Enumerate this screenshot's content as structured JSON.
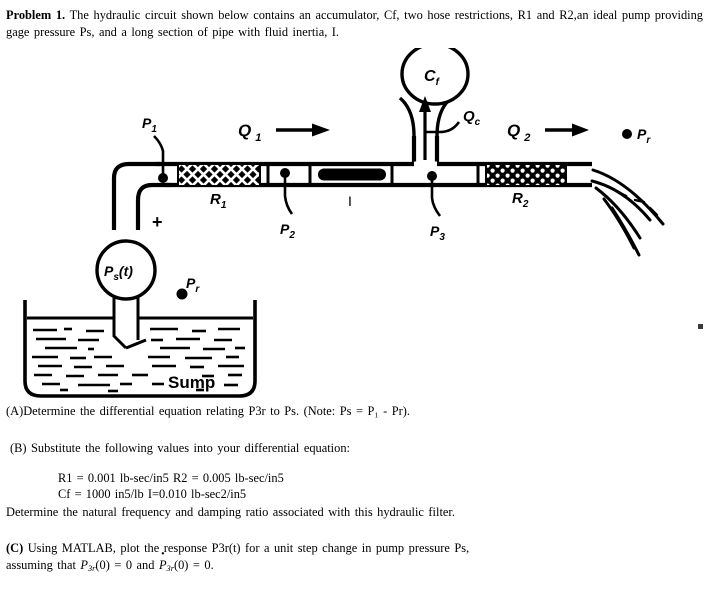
{
  "document": {
    "type": "homework-problem",
    "problem_label": "Problem 1.",
    "statement": "The hydraulic  circuit  shown  below  contains  an accumulator,  Cf, two hose restrictions,  R1 and R2,an ideal pump providing  gage pressure Ps, and a long section of pipe with  fluid  inertia,  I.",
    "part_a": "(A)Determine  the differential  equation  relating  P3r to Ps. (Note: Ps = P₁ - Pr).",
    "part_b": "(B) Substitute  the following  values  into  your differential  equation:",
    "values_line_1": "R1 = 0.001 lb-sec/in5  R2 = 0.005 lb-sec/in5",
    "values_line_2": "Cf = 1000 in5/lb  I=0.010 lb-sec2/in5",
    "part_b_tail": "Determine  the natural  frequency  and damping  ratio  associated  with this hydraulic  filter.",
    "part_c_label": "(C)",
    "part_c_line_1": "Using  MATLAB,  plot  the response  P3r(t) for a unit  step change  in pump  pressure  Ps,",
    "part_c_line_2_pre": "assuming  that ",
    "part_c_P": "P",
    "part_c_sub": "3r",
    "part_c_mid": "(0) = 0 and ",
    "part_c_end": "(0) = 0."
  },
  "figure": {
    "name": "hydraulic-circuit-schematic",
    "labels": {
      "p1": "P",
      "p1_sub": "1",
      "p2": "P",
      "p2_sub": "2",
      "p3": "P",
      "p3_sub": "3",
      "pr": "P",
      "pr_sub": "r",
      "pr2": "P",
      "pr2_sub": "r",
      "q1": "Q",
      "q1_sub": "1",
      "q2": "Q",
      "q2_sub": "2",
      "qc": "Q",
      "qc_sub": "c",
      "r1": "R",
      "r1_sub": "1",
      "r2": "R",
      "r2_sub": "2",
      "cf": "C",
      "cf_sub": "f",
      "inertia": "I",
      "pump": "P",
      "pump_sub": "s",
      "pump_arg": "(t)",
      "sump": "Sump",
      "plus": "+"
    },
    "components": [
      {
        "id": "pump",
        "label": "Ps(t)",
        "kind": "ideal-pump-source"
      },
      {
        "id": "restriction-r1",
        "label": "R1",
        "kind": "hose-restriction"
      },
      {
        "id": "restriction-r2",
        "label": "R2",
        "kind": "hose-restriction"
      },
      {
        "id": "inertia",
        "label": "I",
        "kind": "fluid-inertia-pipe"
      },
      {
        "id": "accumulator",
        "label": "Cf",
        "kind": "accumulator"
      },
      {
        "id": "sump",
        "label": "Sump",
        "kind": "reservoir"
      }
    ],
    "colors": {
      "ink": "#000000",
      "paper": "#ffffff"
    }
  }
}
